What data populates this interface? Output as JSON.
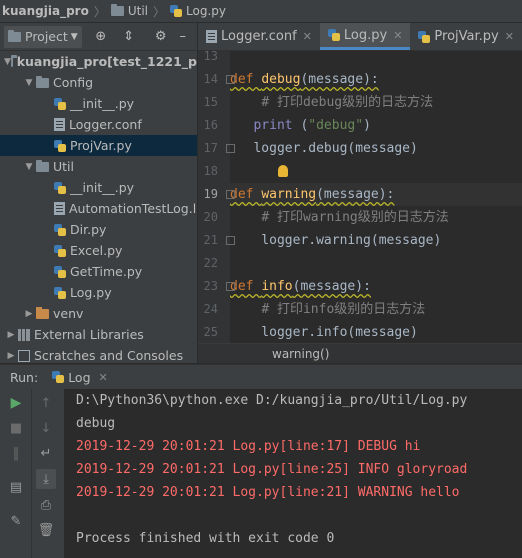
{
  "breadcrumb": [
    "kuangjia_pro",
    "Util",
    "Log.py"
  ],
  "project_panel": {
    "title": "Project",
    "tree": [
      {
        "label": "kuangjia_pro",
        "extra": "[test_1221_p",
        "type": "folder",
        "level": 0,
        "arrow": "down"
      },
      {
        "label": "Config",
        "type": "folder",
        "level": 1,
        "arrow": "down"
      },
      {
        "label": "__init__.py",
        "type": "python",
        "level": 2
      },
      {
        "label": "Logger.conf",
        "type": "conf",
        "level": 2
      },
      {
        "label": "ProjVar.py",
        "type": "python",
        "level": 2,
        "selected": true
      },
      {
        "label": "Util",
        "type": "folder",
        "level": 1,
        "arrow": "down"
      },
      {
        "label": "__init__.py",
        "type": "python",
        "level": 2
      },
      {
        "label": "AutomationTestLog.l",
        "type": "conf",
        "level": 2
      },
      {
        "label": "Dir.py",
        "type": "python",
        "level": 2
      },
      {
        "label": "Excel.py",
        "type": "python",
        "level": 2
      },
      {
        "label": "GetTime.py",
        "type": "python",
        "level": 2
      },
      {
        "label": "Log.py",
        "type": "python",
        "level": 2
      },
      {
        "label": "venv",
        "type": "venv",
        "level": 1,
        "arrow": "right"
      },
      {
        "label": "External Libraries",
        "type": "lib",
        "level": 0,
        "arrow": "right"
      },
      {
        "label": "Scratches and Consoles",
        "type": "scratch",
        "level": 0,
        "arrow": "right"
      }
    ]
  },
  "editor": {
    "tabs": [
      {
        "label": "Logger.conf",
        "icon": "conf",
        "active": false
      },
      {
        "label": "Log.py",
        "icon": "python",
        "active": true
      },
      {
        "label": "ProjVar.py",
        "icon": "python",
        "active": false
      }
    ],
    "line_numbers": [
      "13",
      "14",
      "15",
      "16",
      "17",
      "18",
      "19",
      "20",
      "21",
      "22",
      "23",
      "24",
      "25"
    ],
    "code": [
      {
        "parts": []
      },
      {
        "parts": [
          [
            "kw",
            "def "
          ],
          [
            "fn",
            "debug"
          ],
          [
            "",
            "(message):"
          ]
        ]
      },
      {
        "parts": [
          [
            "",
            "    "
          ],
          [
            "cm",
            "# 打印debug级别的日志方法"
          ]
        ]
      },
      {
        "parts": [
          [
            "",
            "   "
          ],
          [
            "bi",
            "print"
          ],
          [
            "",
            " ("
          ],
          [
            "st",
            "\"debug\""
          ],
          [
            "",
            ")"
          ]
        ]
      },
      {
        "parts": [
          [
            "",
            "   logger.debug(message)"
          ]
        ]
      },
      {
        "parts": []
      },
      {
        "parts": [
          [
            "kw",
            "def "
          ],
          [
            "fn",
            "warning"
          ],
          [
            "",
            "(message):"
          ]
        ]
      },
      {
        "parts": [
          [
            "",
            "    "
          ],
          [
            "cm",
            "# 打印warning级别的日志方法"
          ]
        ]
      },
      {
        "parts": [
          [
            "",
            "    logger.warning(message)"
          ]
        ]
      },
      {
        "parts": []
      },
      {
        "parts": [
          [
            "kw",
            "def "
          ],
          [
            "fn",
            "info"
          ],
          [
            "",
            "(message):"
          ]
        ]
      },
      {
        "parts": [
          [
            "",
            "    "
          ],
          [
            "cm",
            "# 打印info级别的日志方法"
          ]
        ]
      },
      {
        "parts": [
          [
            "",
            "    logger.info(message)"
          ]
        ]
      }
    ],
    "structure_crumb": "warning()"
  },
  "run": {
    "label": "Run:",
    "tab": "Log",
    "console": [
      {
        "text": "D:\\Python36\\python.exe D:/kuangjia_pro/Util/Log.py",
        "color": "#bbbbbb"
      },
      {
        "text": "debug",
        "color": "#bbbbbb"
      },
      {
        "text": "2019-12-29 20:01:21 Log.py[line:17] DEBUG hi",
        "color": "#ff6b68"
      },
      {
        "text": "2019-12-29 20:01:21 Log.py[line:25] INFO gloryroad",
        "color": "#ff6b68"
      },
      {
        "text": "2019-12-29 20:01:21 Log.py[line:21] WARNING hello",
        "color": "#ff6b68"
      },
      {
        "text": "",
        "color": "#bbbbbb"
      },
      {
        "text": "Process finished with exit code 0",
        "color": "#bbbbbb"
      }
    ]
  },
  "colors": {
    "keyword": "#cc7832",
    "function": "#ffc66d",
    "comment": "#808080",
    "string": "#6a8759",
    "error": "#ff6b68",
    "selection": "#0d293e"
  }
}
